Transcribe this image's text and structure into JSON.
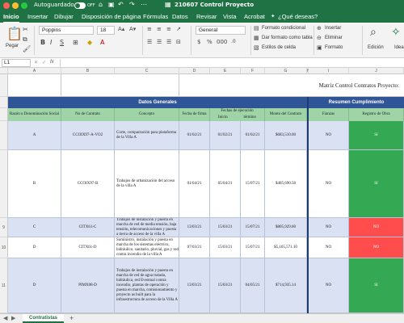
{
  "titlebar": {
    "autosave_label": "Autoguardado",
    "autosave_state": "OFF",
    "title": "210607 Control Proyecto"
  },
  "menu": {
    "tabs": [
      "Inicio",
      "Insertar",
      "Dibujar",
      "Disposición de página",
      "Fórmulas",
      "Datos",
      "Revisar",
      "Vista",
      "Acrobat",
      "¿Qué deseas?"
    ]
  },
  "ribbon": {
    "paste_label": "Pegar",
    "font_name": "Poppins",
    "font_size": "18",
    "number_format": "General",
    "conditional_format": "Formato condicional",
    "table_format": "Dar formato como tabla",
    "cell_styles": "Estilos de celda",
    "insert": "Insertar",
    "delete": "Eliminar",
    "format": "Formato",
    "edit_label": "Edición",
    "ideas_label": "Idea"
  },
  "formula_bar": {
    "name_box": "L1",
    "fx": "fx"
  },
  "columns": [
    "A",
    "B",
    "C",
    "D",
    "E",
    "F",
    "G",
    "H",
    "I",
    "J"
  ],
  "sheet": {
    "report_title": "Matriz Control Contratos Proyecto:",
    "band_general": "Datos Generales",
    "band_compliance": "Resumen Cumplimiento",
    "headers": {
      "razon": "Razón o Denominación Social",
      "contrato": "No de Contrato",
      "concepto": "Concepto",
      "firma": "Fecha de firma",
      "periodo": "Fechas de ejecución",
      "inicio": "Inicio",
      "termino": "término",
      "monto": "Monto del Contrato",
      "fianzas": "Fianzas",
      "registro": "Registro de Obra"
    },
    "rows": [
      {
        "num": "",
        "razon": "A",
        "contrato": "CCOIX97-A-VO2",
        "concepto": "Corte, compactación para plataforma de la Villa A",
        "firma": "01/02/21",
        "inicio": "01/02/21",
        "termino": "01/02/21",
        "monto": "$683,510.00",
        "fianzas": "NO",
        "registro": "SI",
        "registro_color": "#34a853"
      },
      {
        "num": "",
        "razon": "B",
        "contrato": "CCOIX97-B",
        "concepto": "Trabajos de urbanización del acceso de la villa A",
        "firma": "01/04/21",
        "inicio": "05/04/21",
        "termino": "15/07/21",
        "monto": "$485,690.58",
        "fianzas": "NO",
        "registro": "SI",
        "registro_color": "#34a853"
      },
      {
        "num": "9",
        "razon": "C",
        "contrato": "CITX61-C",
        "concepto": "Trabajos de instalación y puesta en marcha de red de media tensión, baja tensión, telecomunicaciones y puesta a tierra de acceso de la villa A",
        "firma": "13/03/21",
        "inicio": "15/03/21",
        "termino": "15/07/21",
        "monto": "$805,929.60",
        "fianzas": "NO",
        "registro": "NO",
        "registro_color": "#ff4d4d"
      },
      {
        "num": "10",
        "razon": "D",
        "contrato": "CITX61-D",
        "concepto": "Suministro, instalación y puesta en marcha de los sistemas eléctrico, hidráulico, sanitario, pluvial, gas y red contra incendio de la villa A",
        "firma": "07/03/21",
        "inicio": "15/03/21",
        "termino": "15/07/21",
        "monto": "$5,165,571.10",
        "fianzas": "NO",
        "registro": "NO",
        "registro_color": "#ff4d4d"
      },
      {
        "num": "11",
        "razon": "D",
        "contrato": "PIMX08-D",
        "concepto": "Trabajos de instalación y puesta en marcha de red de agua tratada, hidráulica, red Eventual contra incendio, plantas de operación y puesta en marcha, comisionamiento y proyecto as built para la infraestructura de acceso de la Villa A",
        "firma": "13/03/21",
        "inicio": "15/03/21",
        "termino": "04/05/21",
        "monto": "$714,935.14",
        "fianzas": "NO",
        "registro": "SI",
        "registro_color": "#34a853"
      }
    ]
  },
  "sheet_tabs": {
    "active": "Contratistas",
    "add": "+"
  },
  "colors": {
    "excel_green": "#1f7244",
    "band_blue": "#2f5597",
    "header_green": "#9fd4a7",
    "row_blue": "#d9e1f2"
  }
}
